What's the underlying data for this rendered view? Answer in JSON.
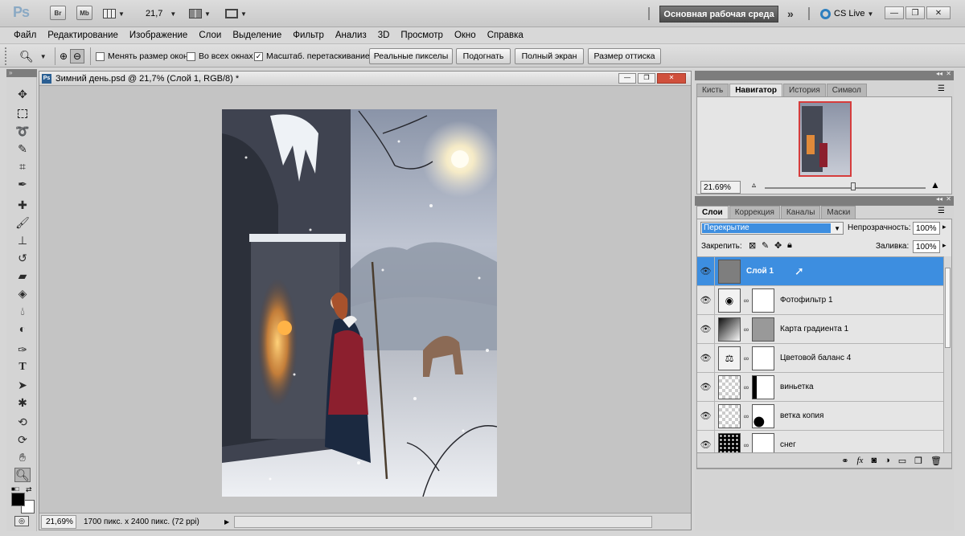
{
  "titlebar": {
    "app_logo": "Ps",
    "bridge_label": "Br",
    "minibridge_label": "Mb",
    "zoom_value": "21,7",
    "workspace_label": "Основная рабочая среда",
    "cslive_label": "CS Live"
  },
  "menu": [
    "Файл",
    "Редактирование",
    "Изображение",
    "Слои",
    "Выделение",
    "Фильтр",
    "Анализ",
    "3D",
    "Просмотр",
    "Окно",
    "Справка"
  ],
  "options": {
    "resize_windows": "Менять размер окон",
    "all_windows": "Во всех окнах",
    "scrubby_zoom": "Масштаб. перетаскиванием",
    "scrubby_checked": "✓",
    "actual_pixels": "Реальные пикселы",
    "fit_screen": "Подогнать",
    "full_screen": "Полный экран",
    "print_size": "Размер оттиска"
  },
  "document": {
    "title": "Зимний день.psd @ 21,7% (Слой 1, RGB/8) *",
    "zoom": "21,69%",
    "doc_info": "1700 пикс. x 2400 пикс. (72 ppi)"
  },
  "navigator": {
    "tabs": [
      "Кисть",
      "Навигатор",
      "История",
      "Символ"
    ],
    "active_tab": 1,
    "zoom": "21.69%",
    "zoom_fraction": 0.55
  },
  "layers_panel": {
    "tabs": [
      "Слои",
      "Коррекция",
      "Каналы",
      "Маски"
    ],
    "active_tab": 0,
    "blend_mode": "Перекрытие",
    "opacity_label": "Непрозрачность:",
    "opacity_value": "100%",
    "lock_label": "Закрепить:",
    "fill_label": "Заливка:",
    "fill_value": "100%",
    "layers": [
      {
        "name": "Слой 1",
        "selected": true,
        "thumb": "gray"
      },
      {
        "name": "Фотофильтр 1",
        "selected": false,
        "thumb": "adjust-photo"
      },
      {
        "name": "Карта градиента 1",
        "selected": false,
        "thumb": "adjust-gradient"
      },
      {
        "name": "Цветовой баланс 4",
        "selected": false,
        "thumb": "adjust-balance"
      },
      {
        "name": "виньетка",
        "selected": false,
        "thumb": "transparent"
      },
      {
        "name": "ветка копия",
        "selected": false,
        "thumb": "transparent"
      },
      {
        "name": "снег",
        "selected": false,
        "thumb": "snow"
      }
    ]
  },
  "colors": {
    "selection": "#3d8ee0",
    "workspace_btn": "#5a5a5a",
    "panel_strip": "#7d7d7d"
  }
}
